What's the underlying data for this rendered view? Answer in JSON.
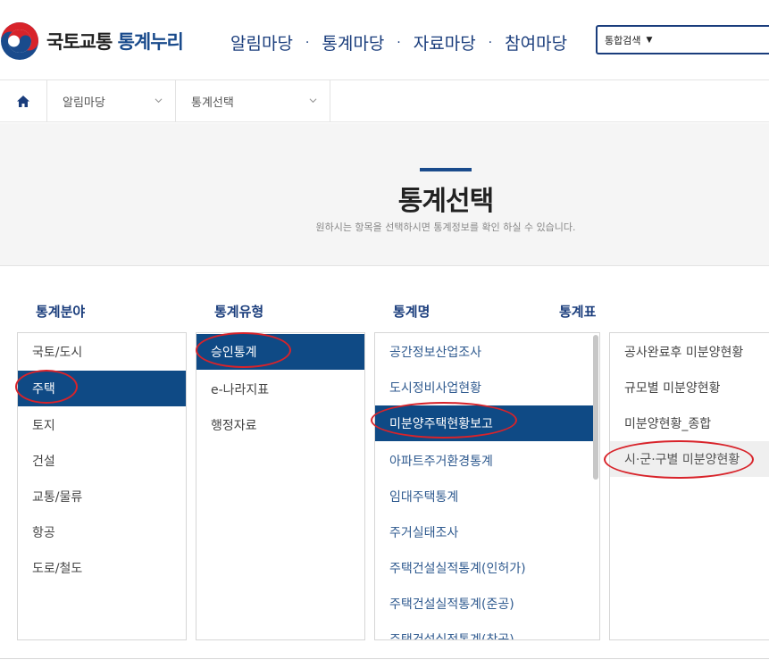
{
  "header": {
    "logo_text_a": "국토교통",
    "logo_text_b": "통계누리",
    "nav": [
      "알림마당",
      "통계마당",
      "자료마당",
      "참여마당"
    ],
    "nav_separator": "·",
    "search_select": "통합검색"
  },
  "breadcrumb": {
    "items": [
      "알림마당",
      "통계선택"
    ]
  },
  "title_band": {
    "title": "통계선택",
    "subtitle": "원하시는 항목을 선택하시면 통계정보를 확인 하실 수 있습니다."
  },
  "columns": {
    "field": {
      "header": "통계분야",
      "items": [
        "국토/도시",
        "주택",
        "토지",
        "건설",
        "교통/물류",
        "항공",
        "도로/철도"
      ],
      "selected": "주택"
    },
    "type": {
      "header": "통계유형",
      "items": [
        "승인통계",
        "e-나라지표",
        "행정자료"
      ],
      "selected": "승인통계"
    },
    "name": {
      "header": "통계명",
      "items": [
        "공간정보산업조사",
        "도시정비사업현황",
        "미분양주택현황보고",
        "아파트주거환경통계",
        "임대주택통계",
        "주거실태조사",
        "주택건설실적통계(인허가)",
        "주택건설실적통계(준공)",
        "주택건설실적통계(착공)"
      ],
      "selected": "미분양주택현황보고"
    },
    "table": {
      "header": "통계표",
      "items": [
        "공사완료후 미분양현황",
        "규모별 미분양현황",
        "미분양현황_종합",
        "시·군·구별 미분양현황"
      ],
      "highlighted": "시·군·구별 미분양현황"
    }
  },
  "colors": {
    "brand": "#1a3d7c",
    "selected_bg": "#0f4a85",
    "annotation_ring": "#d8232a"
  }
}
